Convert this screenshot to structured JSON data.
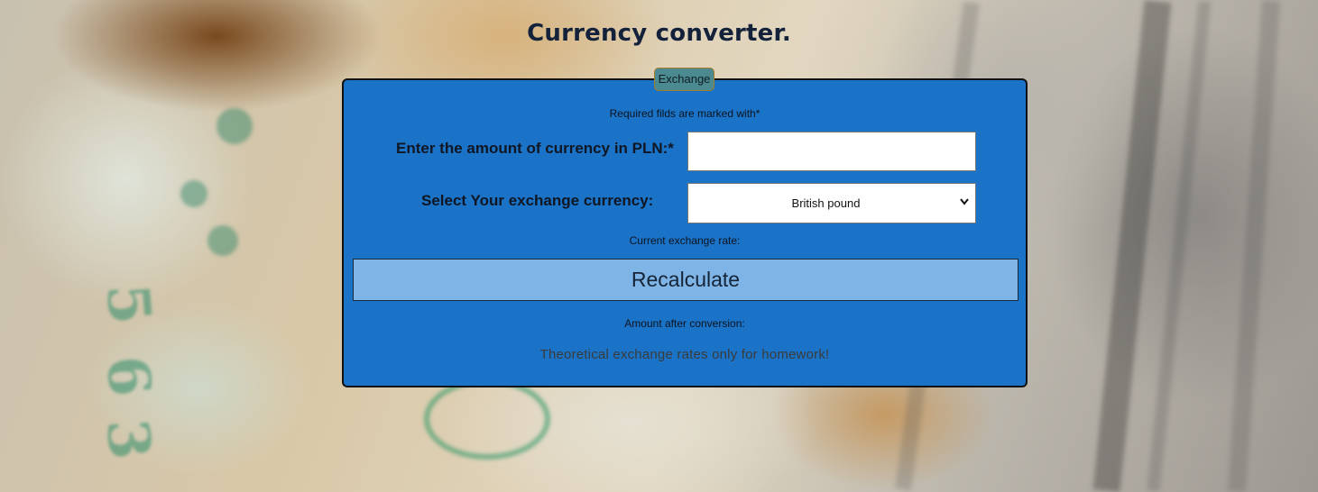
{
  "page": {
    "title": "Currency converter."
  },
  "form": {
    "legend": "Exchange",
    "required_note": "Required filds are marked with*",
    "amount_label": "Enter the amount of currency in PLN:*",
    "amount_value": "",
    "currency_label": "Select Your exchange currency:",
    "currency_selected": "British pound",
    "rate_label": "Current exchange rate:",
    "recalculate_label": "Recalculate",
    "after_label": "Amount after conversion:",
    "footnote": "Theoretical exchange rates only for homework!"
  },
  "colors": {
    "panel": "#1a73c6",
    "button": "#7fb4e6",
    "legend": "#4b8a91"
  },
  "icons": {
    "select_indicator": "chevron-down-icon"
  }
}
